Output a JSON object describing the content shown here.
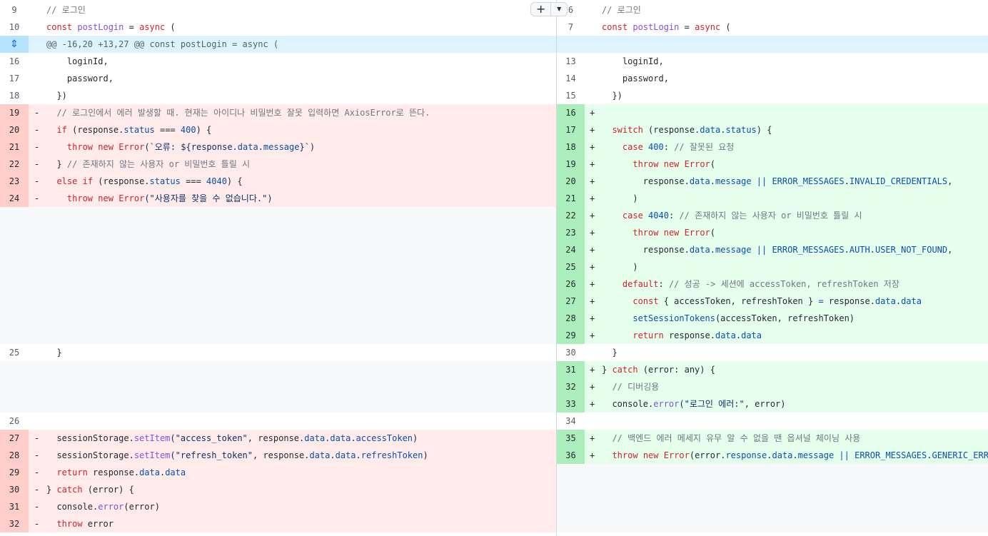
{
  "toolbar": {
    "add_comment_label": "+",
    "menu_icon": "chevron-down-icon"
  },
  "hunk": {
    "header": "@@ -16,20 +13,27 @@ const postLogin = async (",
    "icon": "expand-icon"
  },
  "colors": {
    "deletion_bg": "#ffebe9",
    "deletion_gutter": "#ffcecb",
    "addition_bg": "#e6ffec",
    "addition_gutter": "#aceebb",
    "hunk_bg": "#ddf4ff"
  },
  "rows": [
    {
      "left": {
        "ln": "9",
        "type": "ctx",
        "code": [
          [
            "// 로그인",
            "cm"
          ]
        ]
      },
      "right": {
        "ln": "6",
        "type": "ctx",
        "code": [
          [
            "// 로그인",
            "cm"
          ]
        ]
      }
    },
    {
      "left": {
        "ln": "10",
        "type": "ctx",
        "code": [
          [
            "const ",
            "kw"
          ],
          [
            "postLogin",
            "fn"
          ],
          [
            " = ",
            "pl"
          ],
          [
            "async",
            "kw"
          ],
          [
            " (",
            "pl"
          ]
        ]
      },
      "right": {
        "ln": "7",
        "type": "ctx",
        "code": [
          [
            "const ",
            "kw"
          ],
          [
            "postLogin",
            "fn"
          ],
          [
            " = ",
            "pl"
          ],
          [
            "async",
            "kw"
          ],
          [
            " (",
            "pl"
          ]
        ]
      }
    },
    {
      "hunk": true
    },
    {
      "left": {
        "ln": "16",
        "type": "ctx",
        "code": [
          [
            "    loginId,",
            "pl"
          ]
        ]
      },
      "right": {
        "ln": "13",
        "type": "ctx",
        "code": [
          [
            "    loginId,",
            "pl"
          ]
        ]
      }
    },
    {
      "left": {
        "ln": "17",
        "type": "ctx",
        "code": [
          [
            "    password,",
            "pl"
          ]
        ]
      },
      "right": {
        "ln": "14",
        "type": "ctx",
        "code": [
          [
            "    password,",
            "pl"
          ]
        ]
      }
    },
    {
      "left": {
        "ln": "18",
        "type": "ctx",
        "code": [
          [
            "  })",
            "pl"
          ]
        ]
      },
      "right": {
        "ln": "15",
        "type": "ctx",
        "code": [
          [
            "  })",
            "pl"
          ]
        ]
      }
    },
    {
      "left": {
        "ln": "19",
        "type": "del",
        "code": [
          [
            "  // 로그인에서 에러 발생할 때. 현재는 아이디나 비밀번호 잘못 입력하면 AxiosError로 뜬다.",
            "cm"
          ]
        ]
      },
      "right": {
        "ln": "16",
        "type": "add",
        "code": []
      }
    },
    {
      "left": {
        "ln": "20",
        "type": "del",
        "code": [
          [
            "  ",
            "pl"
          ],
          [
            "if",
            "kw"
          ],
          [
            " (response.",
            "pl"
          ],
          [
            "status",
            "prop"
          ],
          [
            " === ",
            "pl"
          ],
          [
            "400",
            "num"
          ],
          [
            ") {",
            "pl"
          ]
        ]
      },
      "right": {
        "ln": "17",
        "type": "add",
        "code": [
          [
            "  ",
            "pl"
          ],
          [
            "switch",
            "kw"
          ],
          [
            " (response.",
            "pl"
          ],
          [
            "data",
            "prop"
          ],
          [
            ".",
            "pl"
          ],
          [
            "status",
            "prop"
          ],
          [
            ") {",
            "pl"
          ]
        ]
      }
    },
    {
      "left": {
        "ln": "21",
        "type": "del",
        "code": [
          [
            "    ",
            "pl"
          ],
          [
            "throw",
            "kw"
          ],
          [
            " ",
            "pl"
          ],
          [
            "new",
            "kw"
          ],
          [
            " ",
            "pl"
          ],
          [
            "Error",
            "kw"
          ],
          [
            "(`오류: ${response.",
            "str"
          ],
          [
            "data",
            "prop"
          ],
          [
            ".",
            "str"
          ],
          [
            "message",
            "prop"
          ],
          [
            "}`)",
            "str"
          ]
        ]
      },
      "right": {
        "ln": "18",
        "type": "add",
        "code": [
          [
            "    ",
            "pl"
          ],
          [
            "case",
            "kw"
          ],
          [
            " ",
            "pl"
          ],
          [
            "400",
            "num"
          ],
          [
            ": ",
            "pl"
          ],
          [
            "// 잘못된 요청",
            "cm"
          ]
        ]
      }
    },
    {
      "left": {
        "ln": "22",
        "type": "del",
        "code": [
          [
            "  } ",
            "pl"
          ],
          [
            "// 존재하지 않는 사용자 or 비밀번호 틀릴 시",
            "cm"
          ]
        ]
      },
      "right": {
        "ln": "19",
        "type": "add",
        "code": [
          [
            "      ",
            "pl"
          ],
          [
            "throw",
            "kw"
          ],
          [
            " ",
            "pl"
          ],
          [
            "new",
            "kw"
          ],
          [
            " ",
            "pl"
          ],
          [
            "Error",
            "kw"
          ],
          [
            "(",
            "pl"
          ]
        ]
      }
    },
    {
      "left": {
        "ln": "23",
        "type": "del",
        "code": [
          [
            "  ",
            "pl"
          ],
          [
            "else",
            "kw"
          ],
          [
            " ",
            "pl"
          ],
          [
            "if",
            "kw"
          ],
          [
            " (response.",
            "pl"
          ],
          [
            "status",
            "prop"
          ],
          [
            " === ",
            "pl"
          ],
          [
            "4040",
            "num"
          ],
          [
            ") {",
            "pl"
          ]
        ]
      },
      "right": {
        "ln": "20",
        "type": "add",
        "code": [
          [
            "        response.",
            "pl"
          ],
          [
            "data",
            "prop"
          ],
          [
            ".",
            "pl"
          ],
          [
            "message",
            "prop"
          ],
          [
            " || ",
            "prop"
          ],
          [
            "ERROR_MESSAGES",
            "prop"
          ],
          [
            ".",
            "pl"
          ],
          [
            "INVALID_CREDENTIALS",
            "prop"
          ],
          [
            ",",
            "pl"
          ]
        ]
      }
    },
    {
      "left": {
        "ln": "24",
        "type": "del",
        "code": [
          [
            "    ",
            "pl"
          ],
          [
            "throw",
            "kw"
          ],
          [
            " ",
            "pl"
          ],
          [
            "new",
            "kw"
          ],
          [
            " ",
            "pl"
          ],
          [
            "Error",
            "kw"
          ],
          [
            "(\"사용자를 찾을 수 없습니다.\")",
            "str"
          ]
        ]
      },
      "right": {
        "ln": "21",
        "type": "add",
        "code": [
          [
            "      )",
            "pl"
          ]
        ]
      }
    },
    {
      "left": {
        "type": "empty"
      },
      "right": {
        "ln": "22",
        "type": "add",
        "code": [
          [
            "    ",
            "pl"
          ],
          [
            "case",
            "kw"
          ],
          [
            " ",
            "pl"
          ],
          [
            "4040",
            "num"
          ],
          [
            ": ",
            "pl"
          ],
          [
            "// 존재하지 않는 사용자 or 비밀번호 틀릴 시",
            "cm"
          ]
        ]
      }
    },
    {
      "left": {
        "type": "empty"
      },
      "right": {
        "ln": "23",
        "type": "add",
        "code": [
          [
            "      ",
            "pl"
          ],
          [
            "throw",
            "kw"
          ],
          [
            " ",
            "pl"
          ],
          [
            "new",
            "kw"
          ],
          [
            " ",
            "pl"
          ],
          [
            "Error",
            "kw"
          ],
          [
            "(",
            "pl"
          ]
        ]
      }
    },
    {
      "left": {
        "type": "empty"
      },
      "right": {
        "ln": "24",
        "type": "add",
        "code": [
          [
            "        response.",
            "pl"
          ],
          [
            "data",
            "prop"
          ],
          [
            ".",
            "pl"
          ],
          [
            "message",
            "prop"
          ],
          [
            " || ",
            "prop"
          ],
          [
            "ERROR_MESSAGES",
            "prop"
          ],
          [
            ".",
            "pl"
          ],
          [
            "AUTH",
            "prop"
          ],
          [
            ".",
            "pl"
          ],
          [
            "USER_NOT_FOUND",
            "prop"
          ],
          [
            ",",
            "pl"
          ]
        ]
      }
    },
    {
      "left": {
        "type": "empty"
      },
      "right": {
        "ln": "25",
        "type": "add",
        "code": [
          [
            "      )",
            "pl"
          ]
        ]
      }
    },
    {
      "left": {
        "type": "empty"
      },
      "right": {
        "ln": "26",
        "type": "add",
        "code": [
          [
            "    ",
            "pl"
          ],
          [
            "default",
            "kw"
          ],
          [
            ": ",
            "pl"
          ],
          [
            "// 성공 -> 세션에 accessToken, refreshToken 저장",
            "cm"
          ]
        ]
      }
    },
    {
      "left": {
        "type": "empty"
      },
      "right": {
        "ln": "27",
        "type": "add",
        "code": [
          [
            "      ",
            "pl"
          ],
          [
            "const",
            "kw"
          ],
          [
            " { accessToken, refreshToken } ",
            "pl"
          ],
          [
            "=",
            "prop"
          ],
          [
            " response.",
            "pl"
          ],
          [
            "data",
            "prop"
          ],
          [
            ".",
            "pl"
          ],
          [
            "data",
            "prop"
          ]
        ]
      }
    },
    {
      "left": {
        "type": "empty"
      },
      "right": {
        "ln": "28",
        "type": "add",
        "code": [
          [
            "      ",
            "pl"
          ],
          [
            "setSessionTokens",
            "prop"
          ],
          [
            "(accessToken, refreshToken)",
            "pl"
          ]
        ]
      }
    },
    {
      "left": {
        "type": "empty"
      },
      "right": {
        "ln": "29",
        "type": "add",
        "code": [
          [
            "      ",
            "pl"
          ],
          [
            "return",
            "kw"
          ],
          [
            " response.",
            "pl"
          ],
          [
            "data",
            "prop"
          ],
          [
            ".",
            "pl"
          ],
          [
            "data",
            "prop"
          ]
        ]
      }
    },
    {
      "left": {
        "ln": "25",
        "type": "ctx",
        "code": [
          [
            "  }",
            "pl"
          ]
        ]
      },
      "right": {
        "ln": "30",
        "type": "ctx",
        "code": [
          [
            "  }",
            "pl"
          ]
        ]
      }
    },
    {
      "left": {
        "type": "empty"
      },
      "right": {
        "ln": "31",
        "type": "add",
        "code": [
          [
            "} ",
            "pl"
          ],
          [
            "catch",
            "kw"
          ],
          [
            " (error: any) {",
            "pl"
          ]
        ]
      }
    },
    {
      "left": {
        "type": "empty"
      },
      "right": {
        "ln": "32",
        "type": "add",
        "code": [
          [
            "  ",
            "pl"
          ],
          [
            "// 디버깅용",
            "cm"
          ]
        ]
      }
    },
    {
      "left": {
        "type": "empty"
      },
      "right": {
        "ln": "33",
        "type": "add",
        "code": [
          [
            "  console.",
            "pl"
          ],
          [
            "error",
            "fn"
          ],
          [
            "(\"로그인 에러:\"",
            "str"
          ],
          [
            ", error)",
            "pl"
          ]
        ]
      }
    },
    {
      "left": {
        "ln": "26",
        "type": "ctx",
        "code": []
      },
      "right": {
        "ln": "34",
        "type": "ctx",
        "code": []
      }
    },
    {
      "left": {
        "ln": "27",
        "type": "del",
        "code": [
          [
            "  sessionStorage.",
            "pl"
          ],
          [
            "setItem",
            "fn"
          ],
          [
            "(\"access_token\"",
            "str"
          ],
          [
            ", response.",
            "pl"
          ],
          [
            "data",
            "prop"
          ],
          [
            ".",
            "pl"
          ],
          [
            "data",
            "prop"
          ],
          [
            ".",
            "pl"
          ],
          [
            "accessToken",
            "prop"
          ],
          [
            ")",
            "pl"
          ]
        ]
      },
      "right": {
        "ln": "35",
        "type": "add",
        "code": [
          [
            "  ",
            "pl"
          ],
          [
            "// 백엔드 에러 메세지 유무 알 수 없을 땐 옵셔널 체이닝 사용",
            "cm"
          ]
        ]
      }
    },
    {
      "left": {
        "ln": "28",
        "type": "del",
        "code": [
          [
            "  sessionStorage.",
            "pl"
          ],
          [
            "setItem",
            "fn"
          ],
          [
            "(\"refresh_token\"",
            "str"
          ],
          [
            ", response.",
            "pl"
          ],
          [
            "data",
            "prop"
          ],
          [
            ".",
            "pl"
          ],
          [
            "data",
            "prop"
          ],
          [
            ".",
            "pl"
          ],
          [
            "refreshToken",
            "prop"
          ],
          [
            ")",
            "pl"
          ]
        ]
      },
      "right": {
        "ln": "36",
        "type": "add",
        "code": [
          [
            "  ",
            "pl"
          ],
          [
            "throw",
            "kw"
          ],
          [
            " ",
            "pl"
          ],
          [
            "new",
            "kw"
          ],
          [
            " ",
            "pl"
          ],
          [
            "Error",
            "kw"
          ],
          [
            "(error.",
            "pl"
          ],
          [
            "response",
            "prop"
          ],
          [
            ".",
            "pl"
          ],
          [
            "data",
            "prop"
          ],
          [
            ".",
            "pl"
          ],
          [
            "message",
            "prop"
          ],
          [
            " || ",
            "prop"
          ],
          [
            "ERROR_MESSAGES",
            "prop"
          ],
          [
            ".",
            "pl"
          ],
          [
            "GENERIC_ERROR",
            "prop"
          ],
          [
            ")",
            "pl"
          ]
        ]
      }
    },
    {
      "left": {
        "ln": "29",
        "type": "del",
        "code": [
          [
            "  ",
            "pl"
          ],
          [
            "return",
            "kw"
          ],
          [
            " response.",
            "pl"
          ],
          [
            "data",
            "prop"
          ],
          [
            ".",
            "pl"
          ],
          [
            "data",
            "prop"
          ]
        ]
      },
      "right": {
        "type": "empty"
      }
    },
    {
      "left": {
        "ln": "30",
        "type": "del",
        "code": [
          [
            "} ",
            "pl"
          ],
          [
            "catch",
            "kw"
          ],
          [
            " (error) {",
            "pl"
          ]
        ]
      },
      "right": {
        "type": "empty"
      }
    },
    {
      "left": {
        "ln": "31",
        "type": "del",
        "code": [
          [
            "  console.",
            "pl"
          ],
          [
            "error",
            "fn"
          ],
          [
            "(error)",
            "pl"
          ]
        ]
      },
      "right": {
        "type": "empty"
      }
    },
    {
      "left": {
        "ln": "32",
        "type": "del",
        "code": [
          [
            "  ",
            "pl"
          ],
          [
            "throw",
            "kw"
          ],
          [
            " error",
            "pl"
          ]
        ]
      },
      "right": {
        "type": "empty"
      }
    }
  ]
}
